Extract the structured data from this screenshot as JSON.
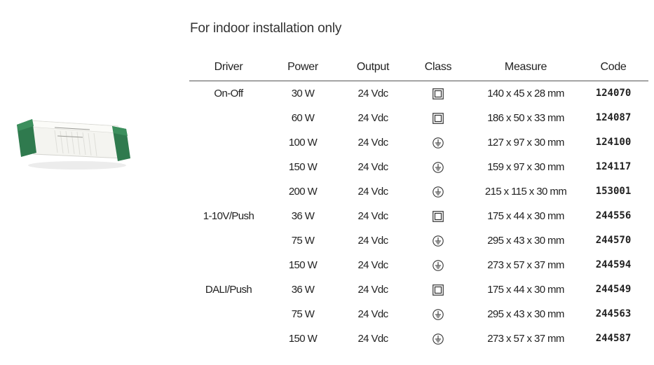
{
  "heading": "For indoor installation only",
  "columns": [
    "Driver",
    "Power",
    "Output",
    "Class",
    "Measure",
    "Code"
  ],
  "rows": [
    {
      "driver": "On-Off",
      "power": "30 W",
      "output": "24 Vdc",
      "class_icon": "class-II-square-icon",
      "measure": "140 x 45 x 28 mm",
      "code": "124070"
    },
    {
      "driver": "",
      "power": "60 W",
      "output": "24 Vdc",
      "class_icon": "class-II-square-icon",
      "measure": "186 x 50 x 33 mm",
      "code": "124087"
    },
    {
      "driver": "",
      "power": "100 W",
      "output": "24 Vdc",
      "class_icon": "class-I-ground-icon",
      "measure": "127 x 97 x 30 mm",
      "code": "124100"
    },
    {
      "driver": "",
      "power": "150 W",
      "output": "24 Vdc",
      "class_icon": "class-I-ground-icon",
      "measure": "159 x 97 x 30 mm",
      "code": "124117"
    },
    {
      "driver": "",
      "power": "200 W",
      "output": "24 Vdc",
      "class_icon": "class-I-ground-icon",
      "measure": "215 x 115 x 30 mm",
      "code": "153001"
    },
    {
      "driver": "1-10V/Push",
      "power": "36 W",
      "output": "24 Vdc",
      "class_icon": "class-II-square-icon",
      "measure": "175 x 44 x 30 mm",
      "code": "244556"
    },
    {
      "driver": "",
      "power": "75 W",
      "output": "24 Vdc",
      "class_icon": "class-I-ground-icon",
      "measure": "295 x 43 x 30 mm",
      "code": "244570"
    },
    {
      "driver": "",
      "power": "150 W",
      "output": "24 Vdc",
      "class_icon": "class-I-ground-icon",
      "measure": "273 x 57 x 37 mm",
      "code": "244594"
    },
    {
      "driver": "DALI/Push",
      "power": "36 W",
      "output": "24 Vdc",
      "class_icon": "class-II-square-icon",
      "measure": "175 x 44 x 30 mm",
      "code": "244549"
    },
    {
      "driver": "",
      "power": "75 W",
      "output": "24 Vdc",
      "class_icon": "class-I-ground-icon",
      "measure": "295 x 43 x 30 mm",
      "code": "244563"
    },
    {
      "driver": "",
      "power": "150 W",
      "output": "24 Vdc",
      "class_icon": "class-I-ground-icon",
      "measure": "273 x 57 x 37 mm",
      "code": "244587"
    }
  ],
  "colors": {
    "driver_body": "#f2f2ee",
    "driver_caps": "#2f7a4e",
    "rule": "#555555"
  }
}
